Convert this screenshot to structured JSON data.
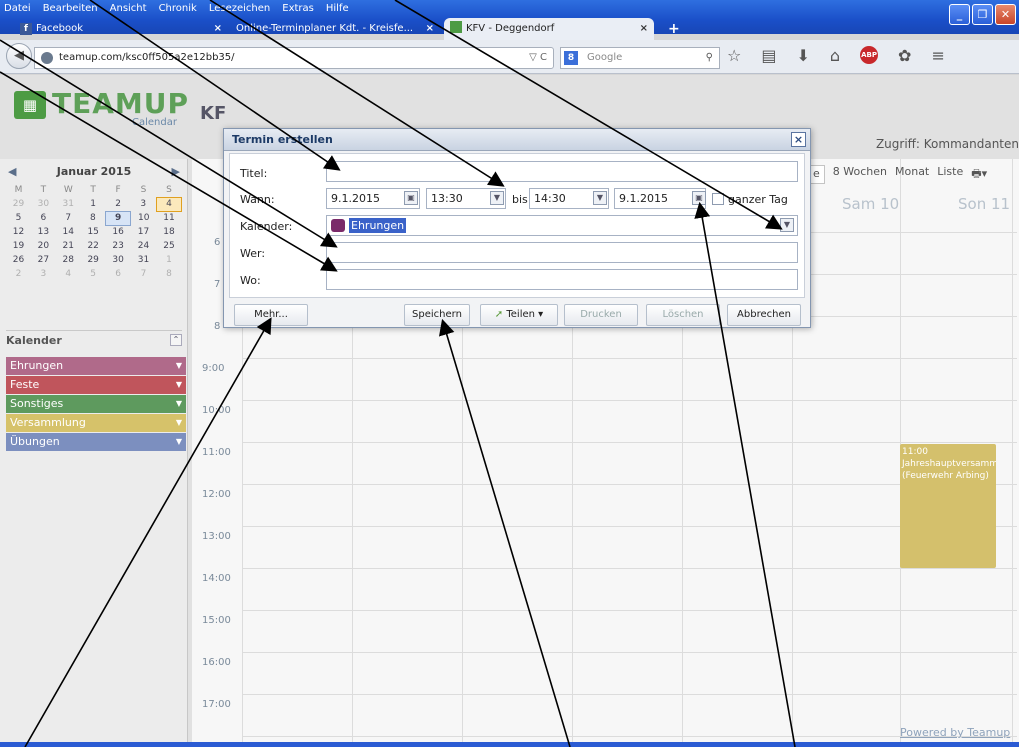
{
  "browser": {
    "menu": [
      "Datei",
      "Bearbeiten",
      "Ansicht",
      "Chronik",
      "Lesezeichen",
      "Extras",
      "Hilfe"
    ],
    "tabs": [
      {
        "label": "Facebook"
      },
      {
        "label": "Online-Terminplaner Kdt. - Kreisfe..."
      },
      {
        "label": "KFV - Deggendorf"
      }
    ],
    "new_tab": "+",
    "url": "teamup.com/ksc0ff505a2e12bb35/",
    "search_placeholder": "Google",
    "close_tab": "×"
  },
  "app": {
    "logo_word": "TEAMUP",
    "logo_sub": "Calendar",
    "calendar_title_partial": "KF",
    "access": "Zugriff: Kommandanten",
    "view_tabs": [
      "e",
      "8 Wochen",
      "Monat",
      "Liste"
    ],
    "day_heads": [
      "Sam 10",
      "Son 11"
    ],
    "powered": "Powered by Teamup"
  },
  "mini_calendar": {
    "month": "Januar 2015",
    "prev": "◀",
    "next": "▶",
    "weekdays": [
      "M",
      "T",
      "W",
      "T",
      "F",
      "S",
      "S"
    ],
    "weeks": [
      [
        "29",
        "30",
        "31",
        "1",
        "2",
        "3",
        "4"
      ],
      [
        "5",
        "6",
        "7",
        "8",
        "9",
        "10",
        "11"
      ],
      [
        "12",
        "13",
        "14",
        "15",
        "16",
        "17",
        "18"
      ],
      [
        "19",
        "20",
        "21",
        "22",
        "23",
        "24",
        "25"
      ],
      [
        "26",
        "27",
        "28",
        "29",
        "30",
        "31",
        "1"
      ],
      [
        "2",
        "3",
        "4",
        "5",
        "6",
        "7",
        "8"
      ]
    ]
  },
  "calendars": {
    "header": "Kalender",
    "items": [
      {
        "label": "Ehrungen",
        "color": "#b06a8a"
      },
      {
        "label": "Feste",
        "color": "#c0555c"
      },
      {
        "label": "Sonstiges",
        "color": "#5e9a5e"
      },
      {
        "label": "Versammlung",
        "color": "#d6c26a"
      },
      {
        "label": "Übungen",
        "color": "#7c8fbf"
      }
    ]
  },
  "hours": [
    "6",
    "7",
    "8",
    "9:00",
    "10:00",
    "11:00",
    "12:00",
    "13:00",
    "14:00",
    "15:00",
    "16:00",
    "17:00"
  ],
  "event": {
    "time": "11:00",
    "title": "Jahreshauptversammlung",
    "location": "(Feuerwehr Arbing)"
  },
  "dialog": {
    "title": "Termin erstellen",
    "close": "×",
    "labels": {
      "title": "Titel:",
      "when": "Wann:",
      "calendar": "Kalender:",
      "who": "Wer:",
      "where": "Wo:"
    },
    "start_date": "9.1.2015",
    "start_time": "13:30",
    "bis": "bis",
    "end_time": "14:30",
    "end_date": "9.1.2015",
    "allday": "ganzer Tag",
    "calendar_value": "Ehrungen",
    "calendar_color": "#7a2a6a",
    "buttons": {
      "more": "Mehr...",
      "save": "Speichern",
      "share": "Teilen",
      "print": "Drucken",
      "delete": "Löschen",
      "cancel": "Abbrechen"
    }
  }
}
